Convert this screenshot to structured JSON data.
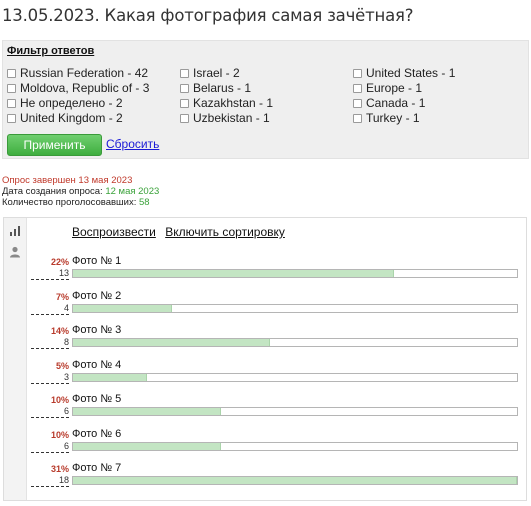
{
  "title": "13.05.2023. Какая фотография самая зачётная?",
  "filter": {
    "heading": "Фильтр ответов",
    "items": [
      "Russian Federation - 42",
      "Moldova, Republic of - 3",
      "Не определено - 2",
      "United Kingdom - 2",
      "Israel - 2",
      "Belarus - 1",
      "Kazakhstan - 1",
      "Uzbekistan - 1",
      "United States - 1",
      "Europe - 1",
      "Canada - 1",
      "Turkey - 1"
    ],
    "apply_label": "Применить",
    "reset_label": "Сбросить"
  },
  "meta": {
    "closed": "Опрос завершен 13 мая 2023",
    "created_label": "Дата создания опроса:",
    "created_value": "12 мая 2023",
    "voters_label": "Количество проголосовавших:",
    "voters_value": "58"
  },
  "toolbar": {
    "play_label": "Воспроизвести",
    "sort_label": "Включить сортировку"
  },
  "icons": {
    "stats": "bar-chart-icon",
    "user": "user-icon"
  },
  "colors": {
    "accent_green": "#4caf50",
    "bar_fill": "#c3e5c3",
    "percent": "#b83a2b",
    "link": "#1b1bd6"
  },
  "results": [
    {
      "percent": "22%",
      "count": "13",
      "label": "Фото № 1",
      "fraction": 0.722
    },
    {
      "percent": "7%",
      "count": "4",
      "label": "Фото № 2",
      "fraction": 0.222
    },
    {
      "percent": "14%",
      "count": "8",
      "label": "Фото № 3",
      "fraction": 0.444
    },
    {
      "percent": "5%",
      "count": "3",
      "label": "Фото № 4",
      "fraction": 0.167
    },
    {
      "percent": "10%",
      "count": "6",
      "label": "Фото № 5",
      "fraction": 0.333
    },
    {
      "percent": "10%",
      "count": "6",
      "label": "Фото № 6",
      "fraction": 0.333
    },
    {
      "percent": "31%",
      "count": "18",
      "label": "Фото № 7",
      "fraction": 1.0
    }
  ]
}
